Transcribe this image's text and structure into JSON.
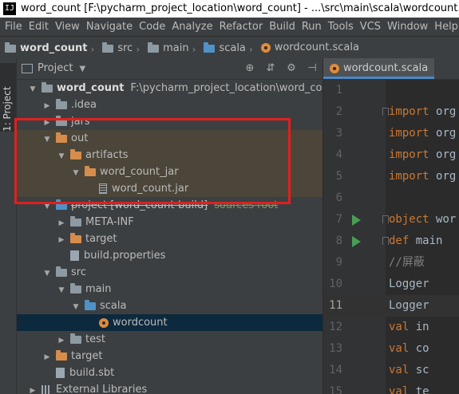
{
  "window": {
    "title": "word_count [F:\\pycharm_project_location\\word_count] - ...\\src\\main\\scala\\wordcount.scala [word_count] - IntelliJ IDEA",
    "app_icon": "IJ"
  },
  "menu": [
    "File",
    "Edit",
    "View",
    "Navigate",
    "Code",
    "Analyze",
    "Refactor",
    "Build",
    "Run",
    "Tools",
    "VCS",
    "Window",
    "Help"
  ],
  "breadcrumb": [
    "word_count",
    "src",
    "main",
    "scala",
    "wordcount.scala"
  ],
  "sidetab": {
    "label": "1: Project"
  },
  "project_panel": {
    "title": "Project"
  },
  "tree": [
    {
      "label": "word_count",
      "path": "F:\\pycharm_project_location\\word_count",
      "tag": "",
      "indent": 0,
      "arrow": "down",
      "icon": "folder-gray",
      "style": "",
      "bold": true
    },
    {
      "label": ".idea",
      "path": "",
      "tag": "",
      "indent": 1,
      "arrow": "right",
      "icon": "folder-gray",
      "style": "",
      "bold": false
    },
    {
      "label": "jars",
      "path": "",
      "tag": "",
      "indent": 1,
      "arrow": "right",
      "icon": "folder-gray",
      "style": "",
      "bold": false
    },
    {
      "label": "out",
      "path": "",
      "tag": "",
      "indent": 1,
      "arrow": "down",
      "icon": "folder-orange",
      "style": "brown",
      "bold": false
    },
    {
      "label": "artifacts",
      "path": "",
      "tag": "",
      "indent": 2,
      "arrow": "down",
      "icon": "folder-orange",
      "style": "brown",
      "bold": false
    },
    {
      "label": "word_count_jar",
      "path": "",
      "tag": "",
      "indent": 3,
      "arrow": "down",
      "icon": "folder-orange",
      "style": "brown",
      "bold": false
    },
    {
      "label": "word_count.jar",
      "path": "",
      "tag": "",
      "indent": 4,
      "arrow": "",
      "icon": "jar",
      "style": "brown",
      "bold": false
    },
    {
      "label": "project [word_count-build]",
      "path": "",
      "tag": "sources root",
      "indent": 1,
      "arrow": "down",
      "icon": "folder-blue",
      "style": "",
      "bold": false,
      "strike": true
    },
    {
      "label": "META-INF",
      "path": "",
      "tag": "",
      "indent": 2,
      "arrow": "right",
      "icon": "folder-gray",
      "style": "",
      "bold": false
    },
    {
      "label": "target",
      "path": "",
      "tag": "",
      "indent": 2,
      "arrow": "right",
      "icon": "folder-orange",
      "style": "",
      "bold": false
    },
    {
      "label": "build.properties",
      "path": "",
      "tag": "",
      "indent": 2,
      "arrow": "",
      "icon": "file",
      "style": "",
      "bold": false
    },
    {
      "label": "src",
      "path": "",
      "tag": "",
      "indent": 1,
      "arrow": "down",
      "icon": "folder-gray",
      "style": "",
      "bold": false
    },
    {
      "label": "main",
      "path": "",
      "tag": "",
      "indent": 2,
      "arrow": "down",
      "icon": "folder-gray",
      "style": "",
      "bold": false
    },
    {
      "label": "scala",
      "path": "",
      "tag": "",
      "indent": 3,
      "arrow": "down",
      "icon": "folder-blue",
      "style": "",
      "bold": false
    },
    {
      "label": "wordcount",
      "path": "",
      "tag": "",
      "indent": 4,
      "arrow": "",
      "icon": "scala-object",
      "style": "sel",
      "bold": false
    },
    {
      "label": "test",
      "path": "",
      "tag": "",
      "indent": 2,
      "arrow": "right",
      "icon": "folder-gray",
      "style": "",
      "bold": false
    },
    {
      "label": "target",
      "path": "",
      "tag": "",
      "indent": 1,
      "arrow": "right",
      "icon": "folder-orange",
      "style": "",
      "bold": false
    },
    {
      "label": "build.sbt",
      "path": "",
      "tag": "",
      "indent": 1,
      "arrow": "",
      "icon": "file",
      "style": "",
      "bold": false
    },
    {
      "label": "External Libraries",
      "path": "",
      "tag": "",
      "indent": 0,
      "arrow": "right",
      "icon": "library",
      "style": "",
      "bold": false
    }
  ],
  "editor": {
    "tab": "wordcount.scala",
    "lines": [
      {
        "num": "1",
        "tokens": []
      },
      {
        "num": "2",
        "tokens": [
          [
            "kw",
            "import "
          ],
          [
            "",
            "org"
          ]
        ]
      },
      {
        "num": "3",
        "tokens": [
          [
            "kw",
            "import "
          ],
          [
            "",
            "org"
          ]
        ]
      },
      {
        "num": "4",
        "tokens": [
          [
            "kw",
            "import "
          ],
          [
            "",
            "org"
          ]
        ]
      },
      {
        "num": "5",
        "tokens": [
          [
            "kw",
            "import "
          ],
          [
            "",
            "org"
          ]
        ]
      },
      {
        "num": "6",
        "tokens": []
      },
      {
        "num": "7",
        "tokens": [
          [
            "kw",
            "object "
          ],
          [
            "",
            "wor"
          ]
        ]
      },
      {
        "num": "8",
        "tokens": [
          [
            "",
            "  "
          ],
          [
            "kw",
            "def "
          ],
          [
            "",
            "main"
          ]
        ]
      },
      {
        "num": "9",
        "tokens": [
          [
            "cm",
            "    //屏蔽"
          ]
        ]
      },
      {
        "num": "10",
        "tokens": [
          [
            "",
            "    Logger"
          ]
        ]
      },
      {
        "num": "11",
        "tokens": [
          [
            "",
            "    Logger"
          ]
        ]
      },
      {
        "num": "12",
        "tokens": [
          [
            "",
            "    "
          ],
          [
            "kw",
            "val "
          ],
          [
            "",
            "in"
          ]
        ]
      },
      {
        "num": "13",
        "tokens": [
          [
            "",
            "    "
          ],
          [
            "kw",
            "val "
          ],
          [
            "",
            "co"
          ]
        ]
      },
      {
        "num": "14",
        "tokens": [
          [
            "",
            "    "
          ],
          [
            "kw",
            "val "
          ],
          [
            "",
            "sc"
          ]
        ]
      },
      {
        "num": "15",
        "tokens": [
          [
            "",
            "    "
          ],
          [
            "kw",
            "val "
          ],
          [
            "",
            "te"
          ]
        ]
      }
    ]
  }
}
